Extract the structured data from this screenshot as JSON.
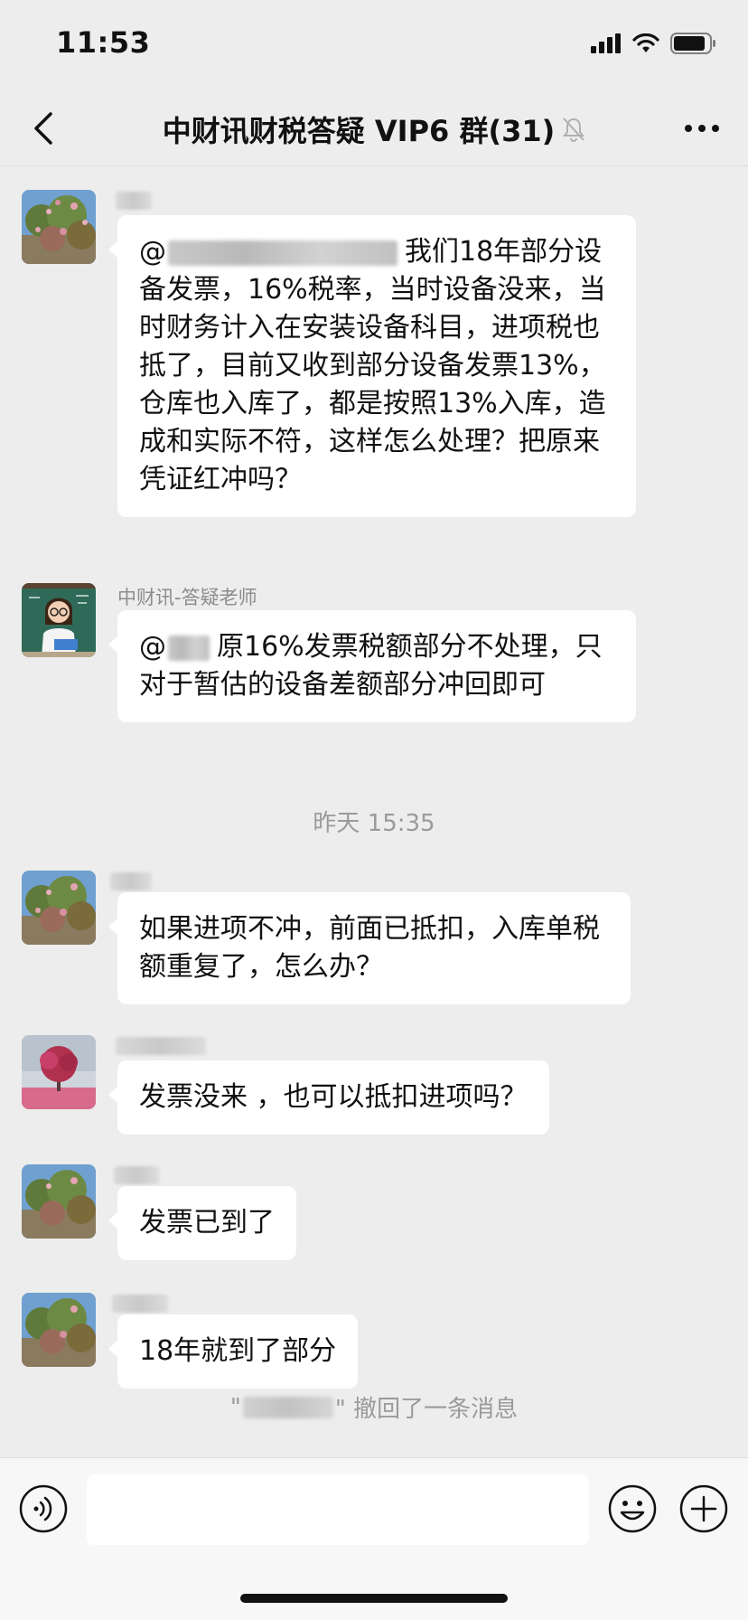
{
  "status_bar": {
    "time": "11:53"
  },
  "nav": {
    "title": "中财讯财税答疑 VIP6 群(31)"
  },
  "messages": [
    {
      "sender": "",
      "text": "我们18年部分设备发票，16%税率，当时设备没来，当时财务计入在安装设备科目，进项税也抵了，目前又收到部分设备发票13%，仓库也入库了，都是按照13%入库，造成和实际不符，这样怎么处理？把原来凭证红冲吗？",
      "mention": "@"
    },
    {
      "sender": "中财讯-答疑老师",
      "text": "原16%发票税额部分不处理，只对于暂估的设备差额部分冲回即可",
      "mention": "@"
    },
    {
      "sender": "",
      "text": "如果进项不冲，前面已抵扣，入库单税额重复了，怎么办？"
    },
    {
      "sender": "",
      "text": "发票没来 ，也可以抵扣进项吗？"
    },
    {
      "sender": "",
      "text": "发票已到了"
    },
    {
      "sender": "",
      "text": "18年就到了部分"
    }
  ],
  "timestamp": "昨天 15:35",
  "recall": {
    "prefix": "\"",
    "suffix": "\" 撤回了一条消息"
  },
  "input": {
    "placeholder": ""
  },
  "icons": {
    "back": "chevron-left-icon",
    "mute": "bell-off-icon",
    "more": "more-icon",
    "voice": "voice-icon",
    "emoji": "emoji-icon",
    "plus": "plus-icon"
  }
}
